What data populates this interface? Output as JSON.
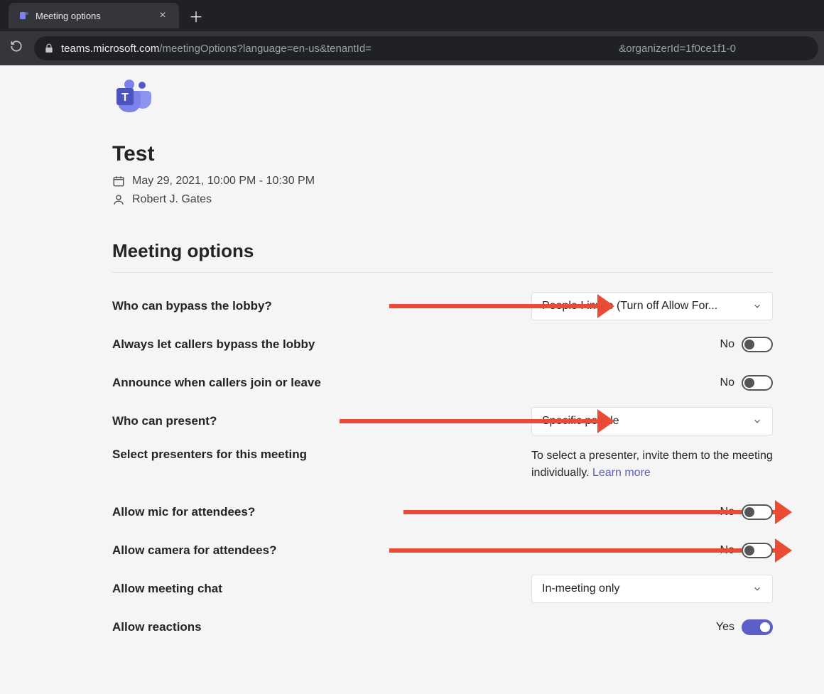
{
  "browser": {
    "tab_title": "Meeting options",
    "url_domain": "teams.microsoft.com",
    "url_path": "/meetingOptions?language=en-us&tenantId=",
    "url_trail": "&organizerId=1f0ce1f1-0"
  },
  "header": {
    "meeting_title": "Test",
    "datetime": "May 29, 2021, 10:00 PM - 10:30 PM",
    "organizer": "Robert J. Gates"
  },
  "section_title": "Meeting options",
  "options": {
    "bypass_lobby": {
      "label": "Who can bypass the lobby?",
      "value": "People I invite (Turn off Allow For..."
    },
    "always_let_callers": {
      "label": "Always let callers bypass the lobby",
      "value": "No",
      "on": false
    },
    "announce": {
      "label": "Announce when callers join or leave",
      "value": "No",
      "on": false
    },
    "who_present": {
      "label": "Who can present?",
      "value": "Specific people"
    },
    "select_presenters": {
      "label": "Select presenters for this meeting",
      "helper": "To select a presenter, invite them to the meeting individually. ",
      "link": "Learn more"
    },
    "allow_mic": {
      "label": "Allow mic for attendees?",
      "value": "No",
      "on": false
    },
    "allow_camera": {
      "label": "Allow camera for attendees?",
      "value": "No",
      "on": false
    },
    "allow_chat": {
      "label": "Allow meeting chat",
      "value": "In-meeting only"
    },
    "allow_reactions": {
      "label": "Allow reactions",
      "value": "Yes",
      "on": true
    }
  }
}
